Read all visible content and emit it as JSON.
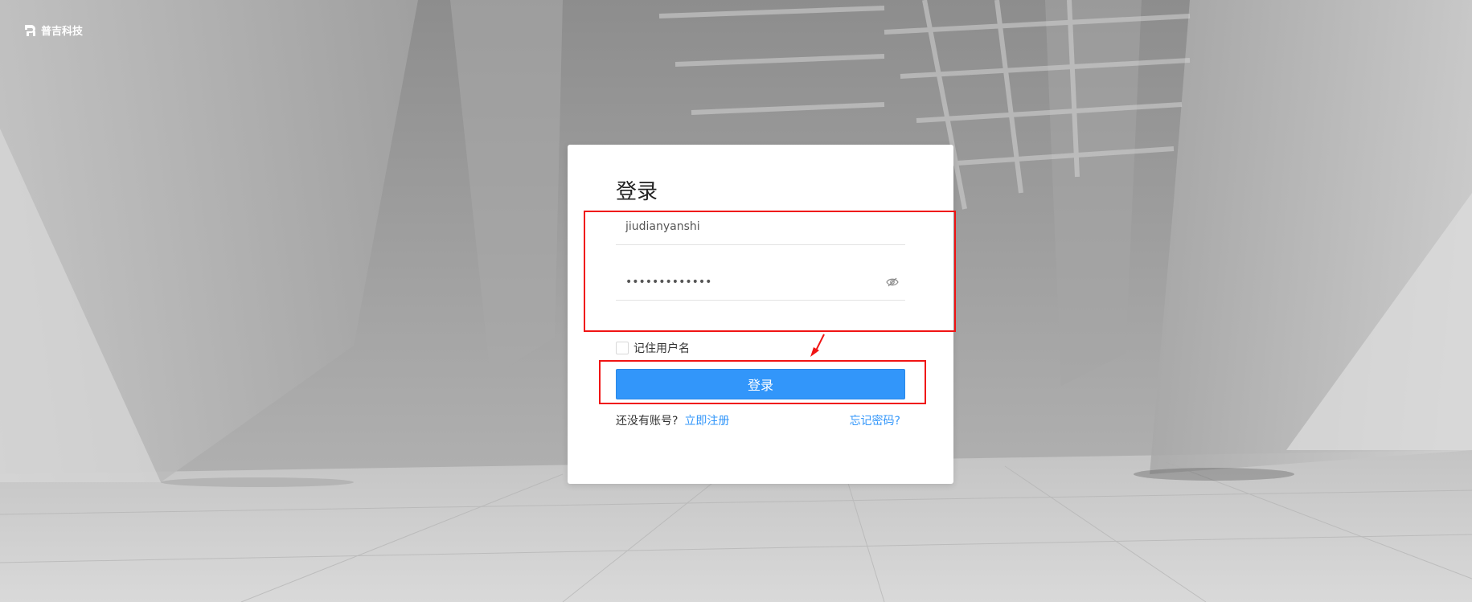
{
  "brand": {
    "name": "普吉科技"
  },
  "login": {
    "title": "登录",
    "username_value": "jiudianyanshi",
    "password_value": "•••••••••••••",
    "remember_label": "记住用户名",
    "remember_checked": false,
    "submit_label": "登录",
    "no_account_text": "还没有账号?",
    "register_link": "立即注册",
    "forgot_link": "忘记密码?"
  },
  "colors": {
    "primary": "#3296fa",
    "annotation": "#f01414"
  },
  "icons": {
    "password_toggle": "eye-slash-icon",
    "brand": "brand-logo-icon"
  }
}
